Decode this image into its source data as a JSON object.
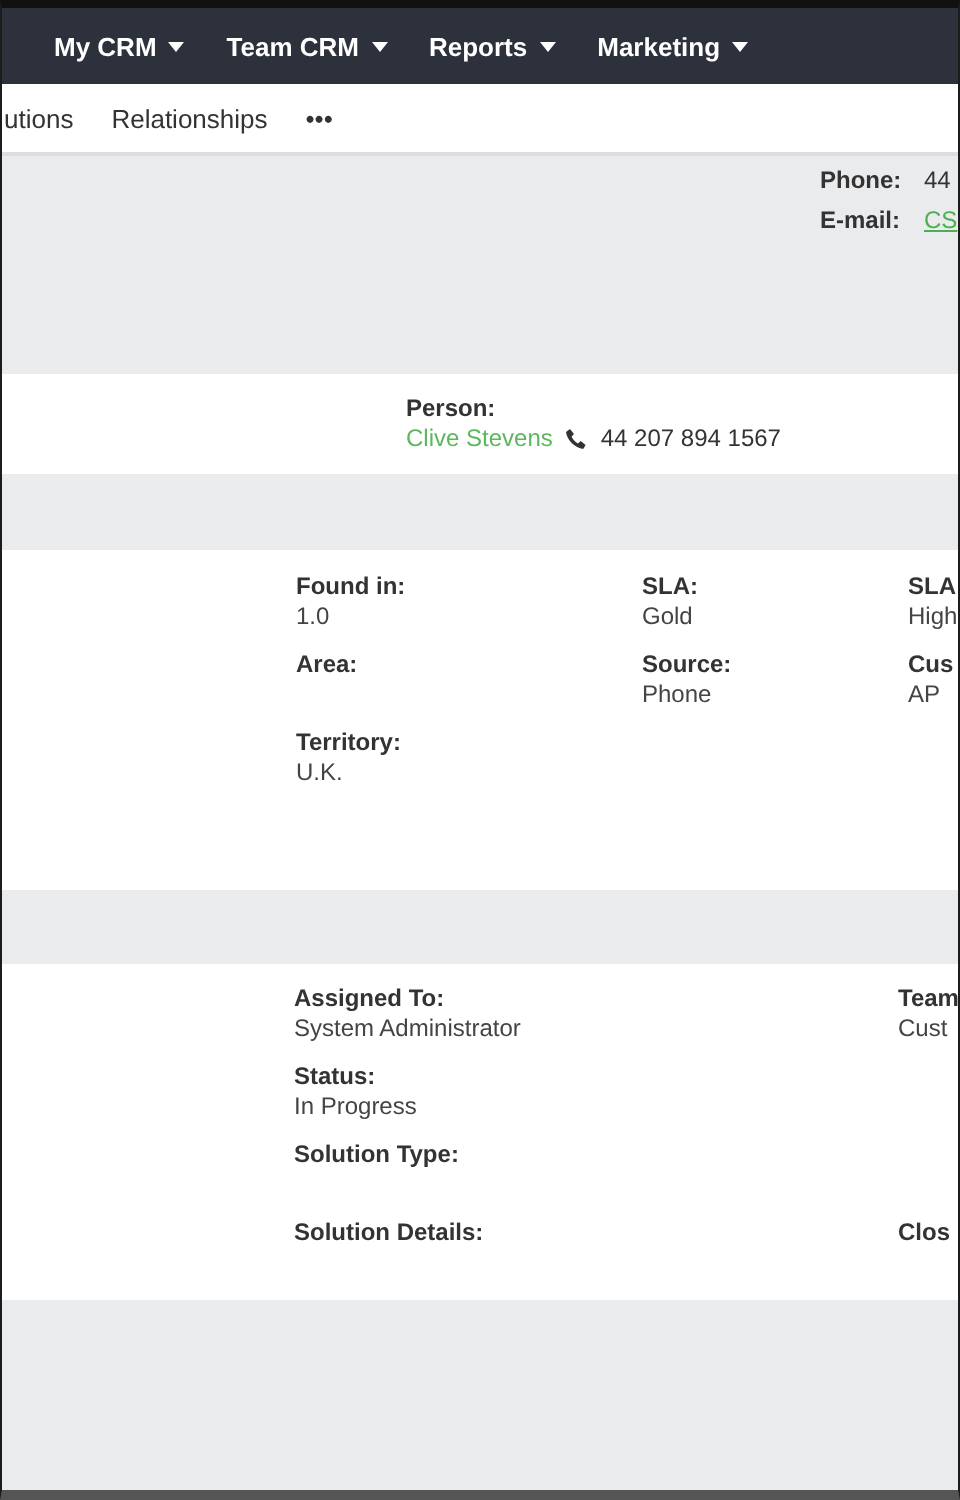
{
  "nav": [
    {
      "label": "My CRM"
    },
    {
      "label": "Team CRM"
    },
    {
      "label": "Reports"
    },
    {
      "label": "Marketing"
    }
  ],
  "tabs": [
    {
      "label": "utions"
    },
    {
      "label": "Relationships"
    },
    {
      "label": "•••"
    }
  ],
  "contact": [
    {
      "label": "Phone:",
      "value": "44",
      "kind": "text"
    },
    {
      "label": "E-mail:",
      "value": "CS",
      "kind": "link"
    }
  ],
  "person": {
    "label": "Person:",
    "name": "Clive Stevens",
    "phone": "44 207 894 1567"
  },
  "sections": [
    {
      "rows": [
        {
          "left": {
            "label": "Found in:",
            "value": "1.0"
          },
          "middle": {
            "label": "SLA:",
            "value": "Gold"
          },
          "right": {
            "label": "SLA",
            "value": "High"
          }
        },
        {
          "left": {
            "label": "Area:"
          },
          "middle": {
            "label": "Source:",
            "value": "Phone"
          },
          "right": {
            "label": "Cus",
            "value": "AP"
          }
        },
        {
          "left": {
            "label": "Territory:",
            "value": "U.K."
          }
        }
      ]
    },
    {
      "rows": [
        {
          "left": {
            "label": "Assigned To:",
            "value": "System Administrator"
          },
          "right": {
            "label": "Team",
            "value": "Cust"
          }
        },
        {
          "left": {
            "label": "Status:",
            "value": "In Progress"
          }
        },
        {
          "left": {
            "label": "Solution Type:"
          }
        },
        {
          "left": {
            "label": "Solution Details:"
          },
          "right": {
            "label": "Clos"
          }
        }
      ]
    }
  ]
}
